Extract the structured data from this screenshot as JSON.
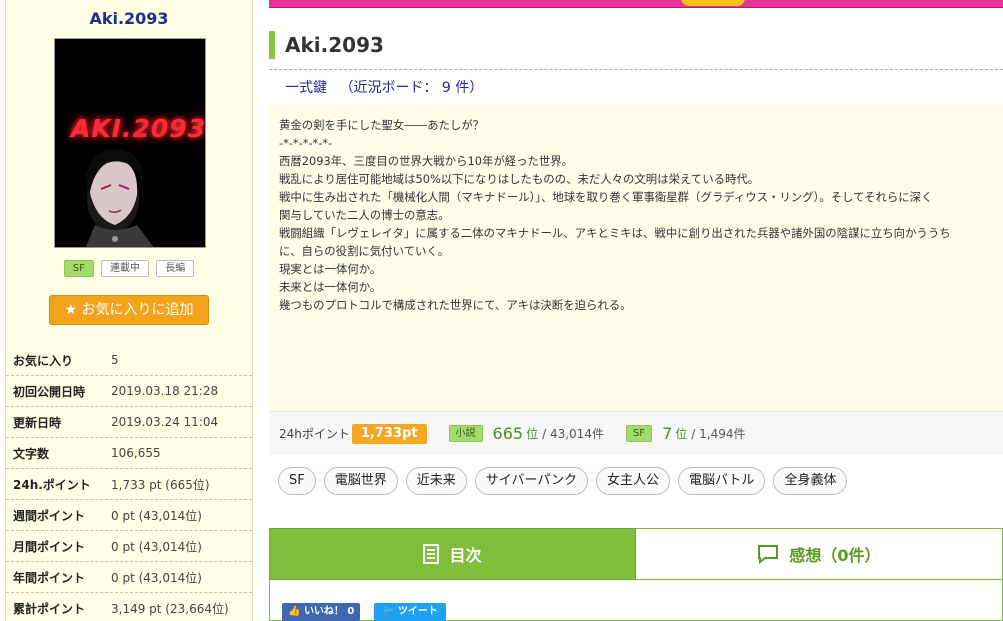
{
  "sidebar": {
    "title": "Aki.2093",
    "cover_text": "AKI.2093",
    "tags": [
      "SF",
      "連載中",
      "長編"
    ],
    "favorite_button": "お気に入りに追加",
    "stats": [
      {
        "label": "お気に入り",
        "value": "5"
      },
      {
        "label": "初回公開日時",
        "value": "2019.03.18 21:28"
      },
      {
        "label": "更新日時",
        "value": "2019.03.24 11:04"
      },
      {
        "label": "文字数",
        "value": "106,655"
      },
      {
        "label": "24h.ポイント",
        "value": "1,733 pt (665位)"
      },
      {
        "label": "週間ポイント",
        "value": "0 pt (43,014位)"
      },
      {
        "label": "月間ポイント",
        "value": "0 pt (43,014位)"
      },
      {
        "label": "年間ポイント",
        "value": "0 pt (43,014位)"
      },
      {
        "label": "累計ポイント",
        "value": "3,149 pt (23,664位)"
      }
    ]
  },
  "main": {
    "title": "Aki.2093",
    "author": "一式鍵",
    "board": "（近況ボード： 9 件）",
    "synopsis": [
      "黄金の剣を手にした聖女――あたしが？",
      "",
      "-*-*-*-*-*-",
      "",
      "西暦2093年、三度目の世界大戦から10年が経った世界。",
      "戦乱により居住可能地域は50%以下になりはしたものの、未だ人々の文明は栄えている時代。",
      "",
      "戦中に生み出された「機械化人間（マキナドール）」、地球を取り巻く軍事衛星群（グラディウス・リング）。そしてそれらに深く",
      "関与していた二人の博士の意志。",
      "",
      "戦闘組織「レヴェレイタ」に属する二体のマキナドール、アキとミキは、戦中に創り出された兵器や諸外国の陰謀に立ち向かううち",
      "に、自らの役割に気付いていく。",
      "",
      "現実とは一体何か。",
      "未来とは一体何か。",
      "幾つものプロトコルで構成された世界にて、アキは決断を迫られる。"
    ],
    "points": {
      "label": "24hポイント",
      "value": "1,733pt",
      "rank1_tag": "小説",
      "rank1_num": "665",
      "rank1_unit": "位",
      "rank1_total": "/ 43,014件",
      "rank2_tag": "SF",
      "rank2_num": "7",
      "rank2_unit": "位",
      "rank2_total": "/ 1,494件"
    },
    "keywords": [
      "SF",
      "電脳世界",
      "近未来",
      "サイバーパンク",
      "女主人公",
      "電脳バトル",
      "全身義体"
    ],
    "tabs": {
      "toc": "目次",
      "impressions": "感想（0件）"
    },
    "share": {
      "like": "いいね！ 0",
      "tweet": "ツイート"
    }
  },
  "colors": {
    "accent_green": "#7fbd3a",
    "favorite_orange": "#f3a21c",
    "banner_pink": "#e8339a",
    "sidebar_bg": "#ffffe6"
  }
}
